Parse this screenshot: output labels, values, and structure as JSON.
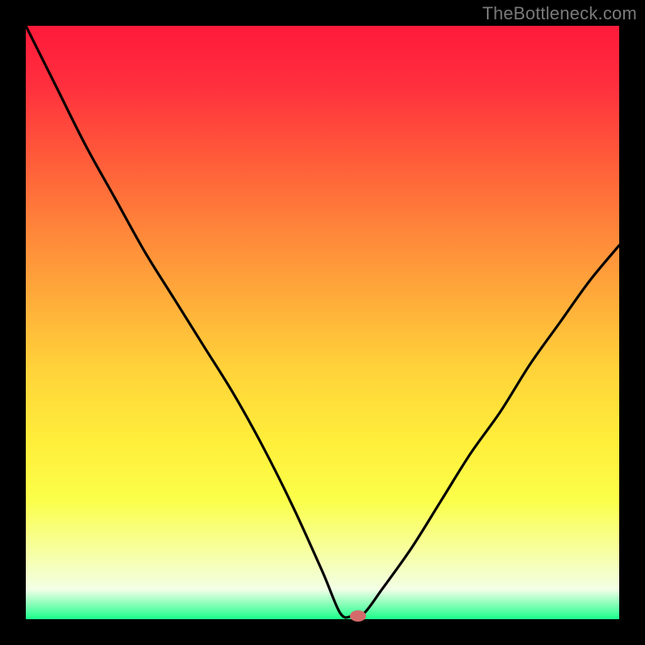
{
  "watermark": "TheBottleneck.com",
  "chart_data": {
    "type": "line",
    "title": "",
    "xlabel": "",
    "ylabel": "",
    "xlim": [
      0,
      100
    ],
    "ylim": [
      0,
      100
    ],
    "background_gradient": {
      "top": "#ff1a3a",
      "mid": "#ffd33a",
      "bottom": "#1aff8a",
      "description": "vertical red-to-green gradient (high=bad, low=good)"
    },
    "series": [
      {
        "name": "bottleneck-curve",
        "x": [
          0,
          5,
          10,
          15,
          20,
          25,
          30,
          35,
          40,
          45,
          50,
          53,
          55,
          57,
          60,
          65,
          70,
          75,
          80,
          85,
          90,
          95,
          100
        ],
        "y": [
          100,
          90,
          80,
          71,
          62,
          54,
          46,
          38,
          29,
          19,
          8,
          1,
          0.5,
          1,
          5,
          12,
          20,
          28,
          35,
          43,
          50,
          57,
          63
        ]
      }
    ],
    "marker": {
      "x": 56,
      "y": 0.5,
      "color": "#d46a6a"
    }
  },
  "colors": {
    "frame": "#000000",
    "watermark": "#7a7a7a",
    "curve": "#000000",
    "marker": "#d46a6a"
  }
}
